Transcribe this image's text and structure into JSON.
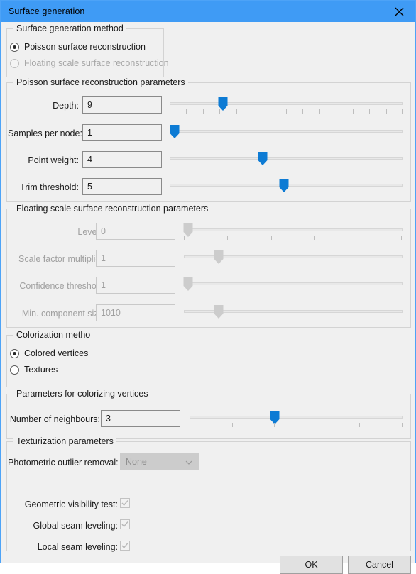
{
  "window": {
    "title": "Surface generation",
    "close_icon": "close-icon",
    "accent": "#3f9bf5",
    "handle_active_color": "#0d7bd4",
    "handle_disabled_color": "#cccccc"
  },
  "method_group": {
    "title": "Surface generation method",
    "options": [
      {
        "label": "Poisson surface reconstruction",
        "checked": true,
        "disabled": false
      },
      {
        "label": "Floating scale surface reconstruction",
        "checked": false,
        "disabled": true
      }
    ]
  },
  "poisson_group": {
    "title": "Poisson surface reconstruction parameters",
    "rows": [
      {
        "label": "Depth:",
        "value": "9",
        "slider_percent": 23,
        "ticks": 15
      },
      {
        "label": "Samples per node:",
        "value": "1",
        "slider_percent": 2,
        "ticks": 0
      },
      {
        "label": "Point weight:",
        "value": "4",
        "slider_percent": 40,
        "ticks": 0
      },
      {
        "label": "Trim threshold:",
        "value": "5",
        "slider_percent": 49,
        "ticks": 0
      }
    ]
  },
  "floating_group": {
    "title": "Floating scale surface reconstruction parameters",
    "disabled": true,
    "rows": [
      {
        "label": "Levels:",
        "value": "0",
        "slider_percent": 2,
        "ticks": 6
      },
      {
        "label": "Scale factor multiplier:",
        "value": "1",
        "slider_percent": 16,
        "ticks": 0
      },
      {
        "label": "Confidence threshold:",
        "value": "1",
        "slider_percent": 2,
        "ticks": 0
      },
      {
        "label": "Min. component size:",
        "value": "1010",
        "slider_percent": 16,
        "ticks": 0
      }
    ]
  },
  "colorization_group": {
    "title": "Colorization method",
    "options": [
      {
        "label": "Colored vertices",
        "checked": true,
        "disabled": false
      },
      {
        "label": "Textures",
        "checked": false,
        "disabled": false
      }
    ]
  },
  "colorizing_group": {
    "title": "Parameters for colorizing vertices",
    "row": {
      "label": "Number of neighbours:",
      "value": "3",
      "slider_percent": 40,
      "ticks": 6
    }
  },
  "texturization_group": {
    "title": "Texturization parameters",
    "disabled": true,
    "combo": {
      "label": "Photometric outlier removal:",
      "value": "None",
      "arrow_icon": "chevron-down-icon"
    },
    "checkboxes": [
      {
        "label": "Geometric visibility test:",
        "checked": true,
        "disabled": true
      },
      {
        "label": "Global seam leveling:",
        "checked": true,
        "disabled": true
      },
      {
        "label": "Local seam leveling:",
        "checked": true,
        "disabled": true
      }
    ]
  },
  "footer": {
    "ok_label": "OK",
    "cancel_label": "Cancel"
  }
}
